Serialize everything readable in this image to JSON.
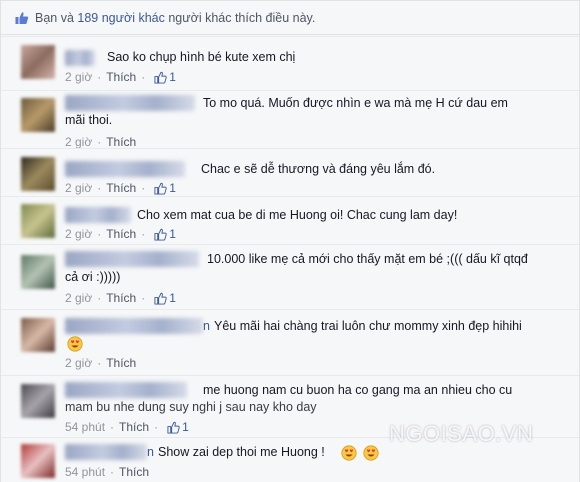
{
  "likes_bar": {
    "prefix": "Bạn và",
    "count_link": "189 người khác",
    "suffix": "người khác thích điều này."
  },
  "actions": {
    "like": "Thích",
    "separator": "·"
  },
  "comments": [
    {
      "text": "Sao ko chụp hình bé kute xem chị",
      "time": "2 giờ",
      "likes": "1"
    },
    {
      "text_line1": "To mo quá. Muốn được nhìn e wa mà mẹ H cứ dau em",
      "text_line2": "mãi thoi.",
      "time": "2 giờ"
    },
    {
      "text": "Chac e sẽ dễ thương và đáng yêu lắm đó.",
      "time": "2 giờ",
      "likes": "1"
    },
    {
      "text": "Cho xem mat cua be di me Huong oi! Chac cung lam day!",
      "time": "2 giờ",
      "likes": "1"
    },
    {
      "text_line1": "10.000 like mẹ cả mới cho thấy mặt em bé ;((( dấu kĩ qtqđ",
      "text_line2": "cả ơi :)))))",
      "time": "2 giờ",
      "likes": "1"
    },
    {
      "name_tail": "n",
      "text": "Yêu mãi hai chàng trai luôn chư mommy xinh đẹp hihihi",
      "time": "2 giờ"
    },
    {
      "text_line1": "me huong nam cu buon ha co gang ma an nhieu cho cu",
      "text_line2": "mam bu nhe dung suy nghi j sau nay kho day",
      "time": "54 phút",
      "likes": "1"
    },
    {
      "name_tail": "n",
      "text": "Show zai dep thoi me Huong !",
      "time": "54 phút"
    }
  ],
  "watermark": "NGOISAO.VN",
  "colors": {
    "link": "#3b5998",
    "text": "#141823",
    "muted": "#90949c",
    "bg": "#f6f7f8"
  }
}
